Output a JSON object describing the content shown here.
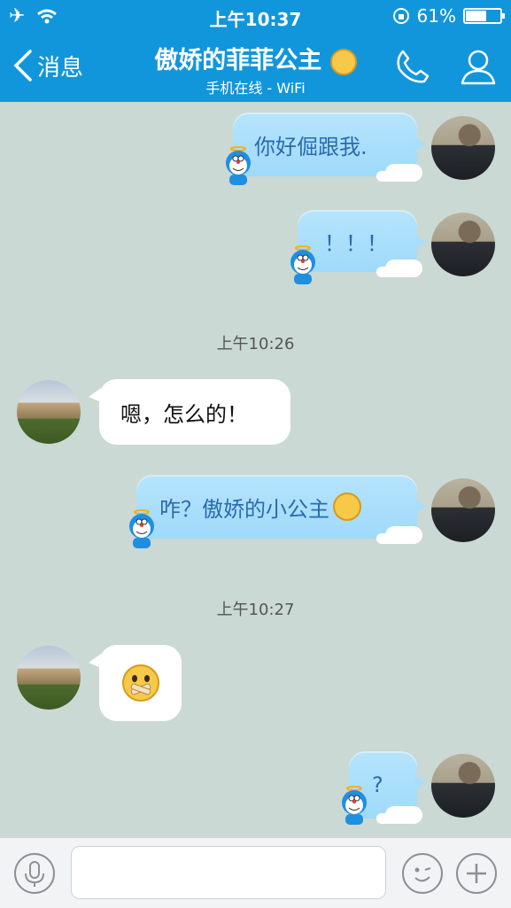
{
  "status": {
    "time": "上午10:37",
    "battery_text": "61%",
    "battery_level": 0.61
  },
  "header": {
    "back_label": "消息",
    "contact_name": "傲娇的菲菲公主",
    "presence": "手机在线 - WiFi"
  },
  "messages": [
    {
      "kind": "out",
      "text": "你好倔跟我."
    },
    {
      "kind": "out",
      "text": "！！！"
    },
    {
      "kind": "time",
      "text": "上午10:26"
    },
    {
      "kind": "in",
      "text": "嗯，怎么的！"
    },
    {
      "kind": "out",
      "text": "咋？傲娇的小公主"
    },
    {
      "kind": "time",
      "text": "上午10:27"
    },
    {
      "kind": "in",
      "text": ""
    },
    {
      "kind": "out",
      "text": "?"
    }
  ],
  "input": {
    "value": "",
    "placeholder": ""
  },
  "icons": {
    "back": "chevron-left-icon",
    "phone": "phone-icon",
    "profile": "person-icon",
    "voice": "microphone-icon",
    "emoji": "wink-face-icon",
    "add": "plus-icon"
  },
  "colors": {
    "header_blue": "#1296db",
    "chat_bg": "#cad9d3",
    "bubble_out": "#a9defb",
    "bubble_in": "#ffffff"
  }
}
